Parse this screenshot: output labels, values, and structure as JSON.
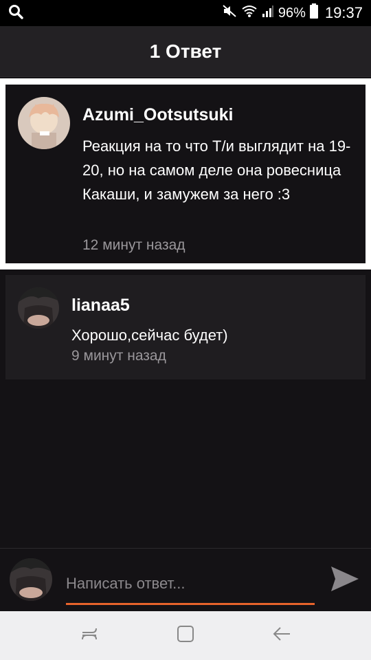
{
  "status_bar": {
    "battery_percent": "96%",
    "time": "19:37",
    "icons": [
      "search-icon",
      "mute-icon",
      "wifi-icon",
      "signal-icon",
      "battery-icon"
    ]
  },
  "header": {
    "title": "1 Ответ"
  },
  "parent_comment": {
    "username": "Azumi_Ootsutsuki",
    "text": "Реакция на то что Т/и выглядит на 19-20, но на самом деле она ровесница Какаши, и замужем за него :3",
    "time": "12 минут назад"
  },
  "replies": [
    {
      "username": "lianaa5",
      "text": "Хорошо,сейчас будет)",
      "time": "9 минут назад"
    }
  ],
  "compose": {
    "placeholder": "Написать ответ...",
    "accent_color": "#e8632b"
  },
  "nav_bar": {
    "icons": [
      "recent-apps-icon",
      "home-icon",
      "back-icon"
    ]
  }
}
